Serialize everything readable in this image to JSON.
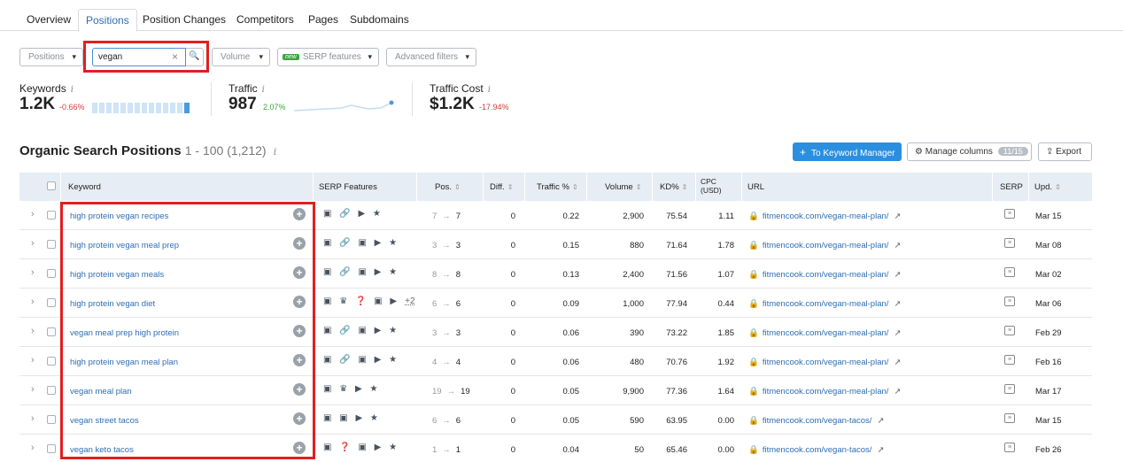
{
  "tabs": [
    {
      "label": "Overview"
    },
    {
      "label": "Positions",
      "active": true
    },
    {
      "label": "Position Changes"
    },
    {
      "label": "Competitors"
    },
    {
      "label": "Pages"
    },
    {
      "label": "Subdomains"
    }
  ],
  "filters": {
    "positions_label": "Positions",
    "search_value": "vegan",
    "clear_glyph": "×",
    "search_glyph": "🔍",
    "volume_label": "Volume",
    "new_badge": "new",
    "serp_label": "SERP features",
    "advanced_label": "Advanced filters"
  },
  "metrics": {
    "keywords": {
      "label": "Keywords",
      "value": "1.2K",
      "delta": "-0.66%"
    },
    "traffic": {
      "label": "Traffic",
      "value": "987",
      "delta": "2.07%"
    },
    "traffic_cost": {
      "label": "Traffic Cost",
      "value": "$1.2K",
      "delta": "-17.94%"
    },
    "info_glyph": "i"
  },
  "section": {
    "title": "Organic Search Positions",
    "range": "1 - 100 (1,212)",
    "to_keyword_manager": "To Keyword Manager",
    "plus_glyph": "+",
    "manage_columns": "Manage columns",
    "columns_count": "11/15",
    "export": "Export"
  },
  "table": {
    "headers": {
      "keyword": "Keyword",
      "serp_features": "SERP Features",
      "pos": "Pos.",
      "diff": "Diff.",
      "traffic_pct": "Traffic %",
      "volume": "Volume",
      "kd": "KD%",
      "cpc_line1": "CPC",
      "cpc_line2": "(USD)",
      "url": "URL",
      "serp": "SERP",
      "upd": "Upd."
    },
    "rows": [
      {
        "keyword": "high protein vegan recipes",
        "serp": "▣ 🔗 ▶ ★",
        "more": "",
        "pos_prev": "7",
        "pos": "7",
        "diff": "0",
        "traffic": "0.22",
        "volume": "2,900",
        "kd": "75.54",
        "cpc": "1.11",
        "url": "fitmencook.com/vegan-meal-plan/",
        "upd": "Mar 15"
      },
      {
        "keyword": "high protein vegan meal prep",
        "serp": "▣ 🔗 ▣ ▶ ★",
        "more": "",
        "pos_prev": "3",
        "pos": "3",
        "diff": "0",
        "traffic": "0.15",
        "volume": "880",
        "kd": "71.64",
        "cpc": "1.78",
        "url": "fitmencook.com/vegan-meal-plan/",
        "upd": "Mar 08"
      },
      {
        "keyword": "high protein vegan meals",
        "serp": "▣ 🔗 ▣ ▶ ★",
        "more": "",
        "pos_prev": "8",
        "pos": "8",
        "diff": "0",
        "traffic": "0.13",
        "volume": "2,400",
        "kd": "71.56",
        "cpc": "1.07",
        "url": "fitmencook.com/vegan-meal-plan/",
        "upd": "Mar 02"
      },
      {
        "keyword": "high protein vegan diet",
        "serp": "▣ ♛ ❓ ▣ ▶",
        "more": "+2",
        "pos_prev": "6",
        "pos": "6",
        "diff": "0",
        "traffic": "0.09",
        "volume": "1,000",
        "kd": "77.94",
        "cpc": "0.44",
        "url": "fitmencook.com/vegan-meal-plan/",
        "upd": "Mar 06"
      },
      {
        "keyword": "vegan meal prep high protein",
        "serp": "▣ 🔗 ▣ ▶ ★",
        "more": "",
        "pos_prev": "3",
        "pos": "3",
        "diff": "0",
        "traffic": "0.06",
        "volume": "390",
        "kd": "73.22",
        "cpc": "1.85",
        "url": "fitmencook.com/vegan-meal-plan/",
        "upd": "Feb 29"
      },
      {
        "keyword": "high protein vegan meal plan",
        "serp": "▣ 🔗 ▣ ▶ ★",
        "more": "",
        "pos_prev": "4",
        "pos": "4",
        "diff": "0",
        "traffic": "0.06",
        "volume": "480",
        "kd": "70.76",
        "cpc": "1.92",
        "url": "fitmencook.com/vegan-meal-plan/",
        "upd": "Feb 16"
      },
      {
        "keyword": "vegan meal plan",
        "serp": "▣ ♛ ▶ ★",
        "more": "",
        "pos_prev": "19",
        "pos": "19",
        "diff": "0",
        "traffic": "0.05",
        "volume": "9,900",
        "kd": "77.36",
        "cpc": "1.64",
        "url": "fitmencook.com/vegan-meal-plan/",
        "upd": "Mar 17"
      },
      {
        "keyword": "vegan street tacos",
        "serp": "▣ ▣ ▶ ★",
        "more": "",
        "pos_prev": "6",
        "pos": "6",
        "diff": "0",
        "traffic": "0.05",
        "volume": "590",
        "kd": "63.95",
        "cpc": "0.00",
        "url": "fitmencook.com/vegan-tacos/",
        "upd": "Mar 15"
      },
      {
        "keyword": "vegan keto tacos",
        "serp": "▣ ❓ ▣ ▶ ★",
        "more": "",
        "pos_prev": "1",
        "pos": "1",
        "diff": "0",
        "traffic": "0.04",
        "volume": "50",
        "kd": "65.46",
        "cpc": "0.00",
        "url": "fitmencook.com/vegan-tacos/",
        "upd": "Feb 26"
      }
    ]
  },
  "colors": {
    "accent": "#2b8fe0",
    "link": "#2e6eb5",
    "highlight": "#e01f1f",
    "positive": "#3fa33f",
    "negative": "#d73a3a"
  }
}
